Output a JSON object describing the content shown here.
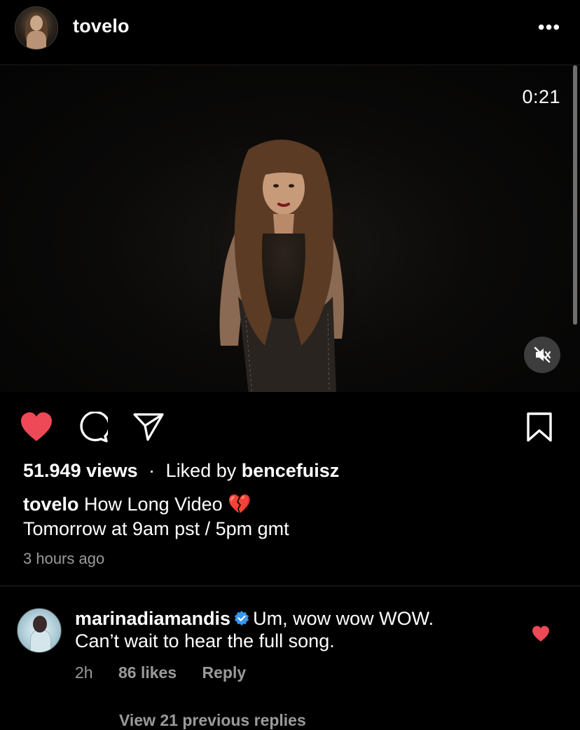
{
  "header": {
    "username": "tovelo",
    "more_label": "•••"
  },
  "video": {
    "timer": "0:21",
    "muted": true
  },
  "actions": {
    "liked": true,
    "like_color": "#ed4956"
  },
  "post": {
    "views": "51.949 views",
    "separator": "·",
    "liked_by_prefix": "Liked by",
    "liked_by_user": "bencefuisz",
    "caption_user": "tovelo",
    "caption_text": "How Long Video",
    "caption_emoji": "💔",
    "caption_line2": "Tomorrow at 9am pst / 5pm gmt",
    "time_ago": "3 hours ago"
  },
  "comment": {
    "username": "marinadiamandis",
    "verified": true,
    "text_line1": "Um, wow wow WOW.",
    "text_line2": "Can’t wait to hear the full song.",
    "age": "2h",
    "likes": "86 likes",
    "reply_label": "Reply",
    "liked": true,
    "view_replies": "View 21 previous replies"
  }
}
